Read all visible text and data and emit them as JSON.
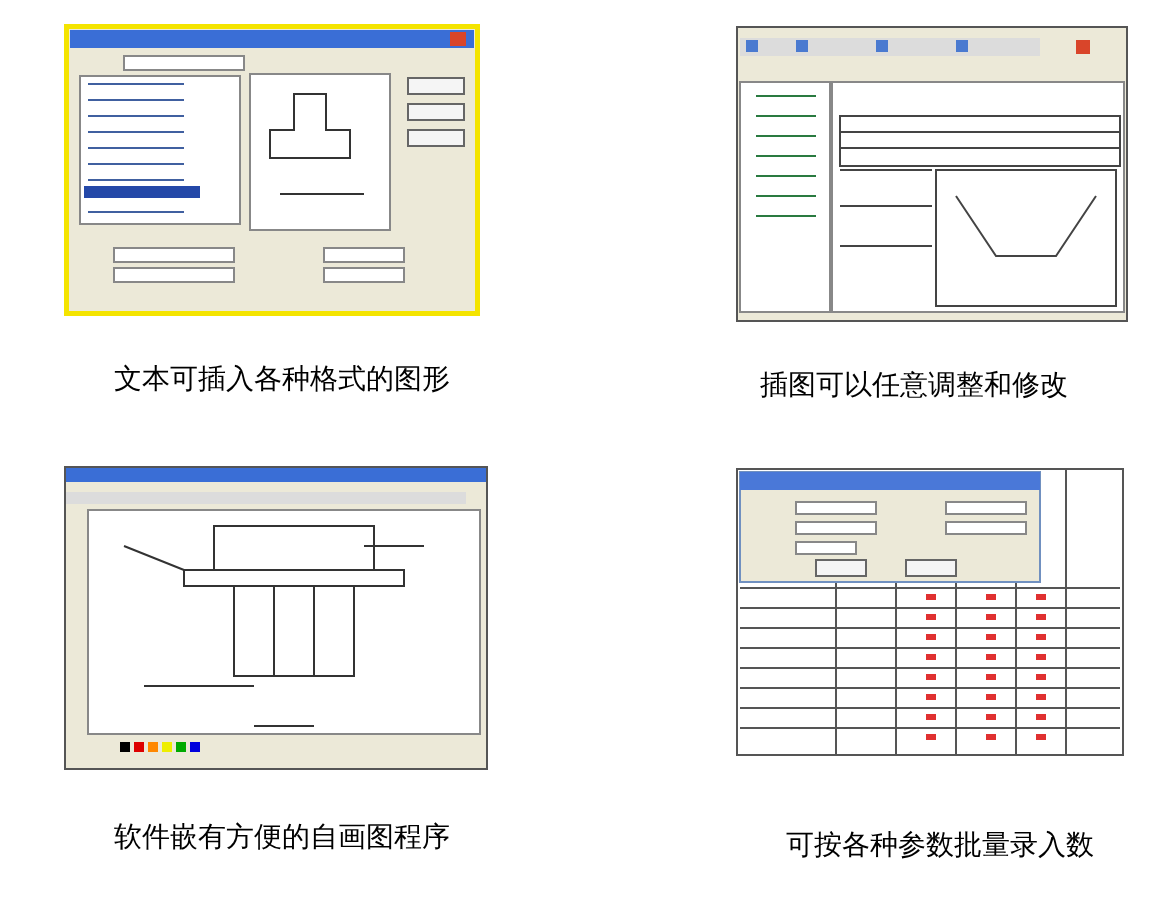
{
  "panels": [
    {
      "kind": "insert-dialog",
      "caption": "文本可插入各种格式的图形"
    },
    {
      "kind": "document-editor",
      "caption": "插图可以任意调整和修改"
    },
    {
      "kind": "drawing-program",
      "caption": "软件嵌有方便的自画图程序"
    },
    {
      "kind": "batch-table",
      "caption": "可按各种参数批量录入数"
    }
  ]
}
